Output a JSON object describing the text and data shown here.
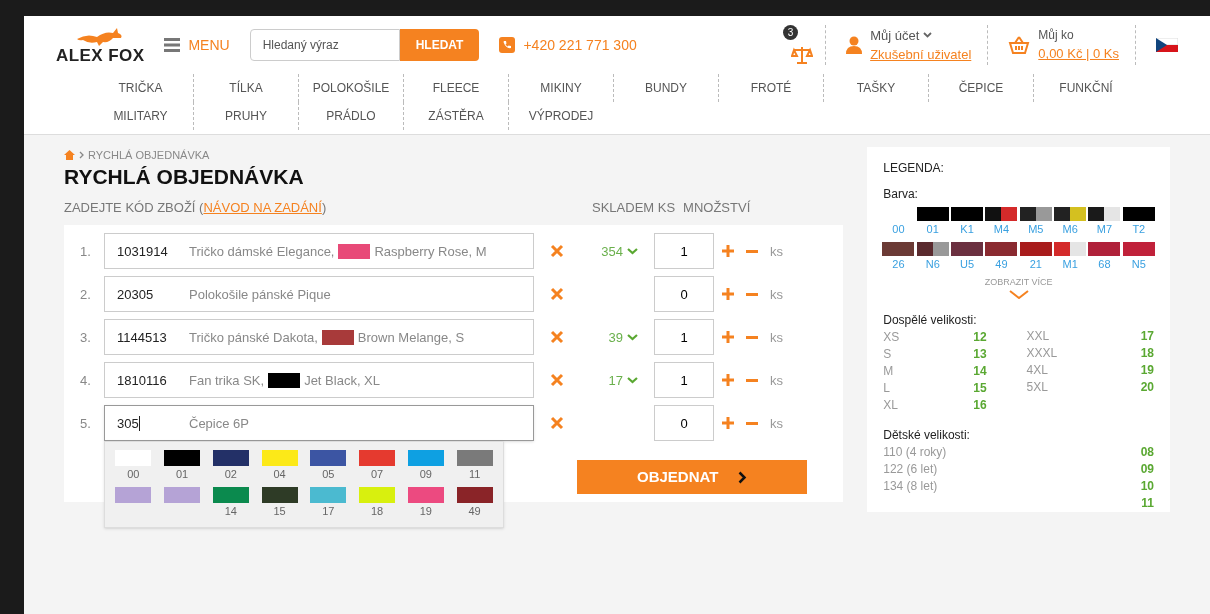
{
  "header": {
    "logo": "ALEX FOX",
    "menu_label": "MENU",
    "search": {
      "placeholder": "Hledaný výraz",
      "button": "HLEDAT"
    },
    "phone": "+420 221 771 300",
    "compare_count": "3",
    "account": {
      "title": "Můj účet",
      "user": "Zkušební uživatel"
    },
    "cart": {
      "title": "Můj ko",
      "summary": "0,00 Kč | 0 Ks"
    }
  },
  "nav": [
    [
      "TRIČKA",
      "TÍLKA",
      "POLOKOŠILE",
      "FLEECE",
      "MIKINY",
      "BUNDY",
      "FROTÉ",
      "TAŠKY",
      "ČEPICE",
      "FUNKČNÍ"
    ],
    [
      "MILITARY",
      "PRUHY",
      "PRÁDLO",
      "ZÁSTĚRA",
      "VÝPRODEJ"
    ]
  ],
  "breadcrumb": "RYCHLÁ OBJEDNÁVKA",
  "title": "RYCHLÁ OBJEDNÁVKA",
  "instruction": {
    "text": "ZADEJTE KÓD ZBOŽÍ (",
    "link": "NÁVOD NA ZADÁNÍ",
    "after": ")"
  },
  "columns": {
    "stock": "SKLADEM KS",
    "quantity": "MNOŽSTVÍ"
  },
  "lines": [
    {
      "number": "1.",
      "code": "1031914",
      "name": "Tričko dámské Elegance,",
      "color": "#e84a78",
      "variant": "Raspberry Rose, M",
      "stock": "354",
      "qty": "1",
      "unit": "ks",
      "focused": false
    },
    {
      "number": "2.",
      "code": "20305",
      "name": "Polokošile pánské Pique",
      "qty": "0",
      "unit": "ks",
      "focused": false
    },
    {
      "number": "3.",
      "code": "1144513",
      "name": "Tričko pánské Dakota,",
      "color": "#a83a3a",
      "variant": "Brown Melange, S",
      "stock": "39",
      "qty": "1",
      "unit": "ks",
      "focused": false
    },
    {
      "number": "4.",
      "code": "1810116",
      "name": "Fan trika SK,",
      "color": "#000000",
      "variant": "Jet Black, XL",
      "stock": "17",
      "qty": "1",
      "unit": "ks",
      "focused": false
    },
    {
      "number": "5.",
      "code": "305",
      "name": "Čepice 6P",
      "qty": "0",
      "unit": "ks",
      "focused": true
    }
  ],
  "color_picker": [
    {
      "color": "#ffffff",
      "code": "00"
    },
    {
      "color": "#000000",
      "code": "01"
    },
    {
      "color": "#233067",
      "code": "02"
    },
    {
      "color": "#fce918",
      "code": "04"
    },
    {
      "color": "#3c55a3",
      "code": "05"
    },
    {
      "color": "#e53a2f",
      "code": "07"
    },
    {
      "color": "#0ea0e2",
      "code": "09"
    },
    {
      "color": "#7a7a7a",
      "code": "11"
    },
    {
      "color": "#b5a3d6"
    },
    {
      "color": "#b5a3d6"
    },
    {
      "color": "#0b8a4e",
      "code": "14"
    },
    {
      "color": "#2e3b26",
      "code": "15"
    },
    {
      "color": "#4bbad0",
      "code": "17"
    },
    {
      "color": "#d8f00e",
      "code": "18"
    },
    {
      "color": "#ec4a80",
      "code": "19"
    },
    {
      "color": "#8a2428",
      "code": "49"
    }
  ],
  "order_button": "OBJEDNAT",
  "legend": {
    "title": "LEGENDA:",
    "color_label": "Barva:",
    "colors": [
      {
        "code": "00"
      },
      {
        "code": "01",
        "color": "#000000"
      },
      {
        "code": "K1",
        "color": "#000000"
      },
      {
        "code": "M4",
        "parts": [
          {
            "color": "#111111"
          },
          {
            "color": "#d42a2a"
          }
        ]
      },
      {
        "code": "M5",
        "parts": [
          {
            "color": "#222222"
          },
          {
            "color": "#999999"
          }
        ]
      },
      {
        "code": "M6",
        "parts": [
          {
            "color": "#222222"
          },
          {
            "color": "#d4c020"
          }
        ]
      },
      {
        "code": "M7",
        "parts": [
          {
            "color": "#1a1a1a"
          },
          {
            "color": "#e5e5e5"
          }
        ]
      },
      {
        "code": "T2",
        "color": "#000000"
      },
      {
        "code": "26",
        "color": "#6b3a35"
      },
      {
        "code": "N6",
        "parts": [
          {
            "color": "#5a2a2e"
          },
          {
            "color": "#999999"
          }
        ]
      },
      {
        "code": "U5",
        "color": "#6b3040"
      },
      {
        "code": "49",
        "color": "#8a2a30"
      },
      {
        "code": "21",
        "color": "#a81c1c"
      },
      {
        "code": "M1",
        "parts": [
          {
            "color": "#d42a2a"
          },
          {
            "color": "#e5e5e5"
          }
        ]
      },
      {
        "code": "68",
        "color": "#b0213a"
      },
      {
        "code": "N5",
        "color": "#c0213a"
      }
    ],
    "more": "ZOBRAZIT VÍCE",
    "adult_title": "Dospělé velikosti:",
    "adult_sizes": [
      {
        "size": "XS",
        "code": "12"
      },
      {
        "size": "S",
        "code": "13"
      },
      {
        "size": "M",
        "code": "14"
      },
      {
        "size": "L",
        "code": "15"
      },
      {
        "size": "XL",
        "code": "16"
      },
      {
        "size": "XXL",
        "code": "17"
      },
      {
        "size": "XXXL",
        "code": "18"
      },
      {
        "size": "4XL",
        "code": "19"
      },
      {
        "size": "5XL",
        "code": "20"
      }
    ],
    "kids_title": "Dětské velikosti:",
    "kids_sizes": [
      {
        "size": "110 (4 roky)",
        "code": "08"
      },
      {
        "size": "122 (6 let)",
        "code": "09"
      },
      {
        "size": "134 (8 let)",
        "code": "10"
      },
      {
        "code": "11"
      }
    ]
  }
}
